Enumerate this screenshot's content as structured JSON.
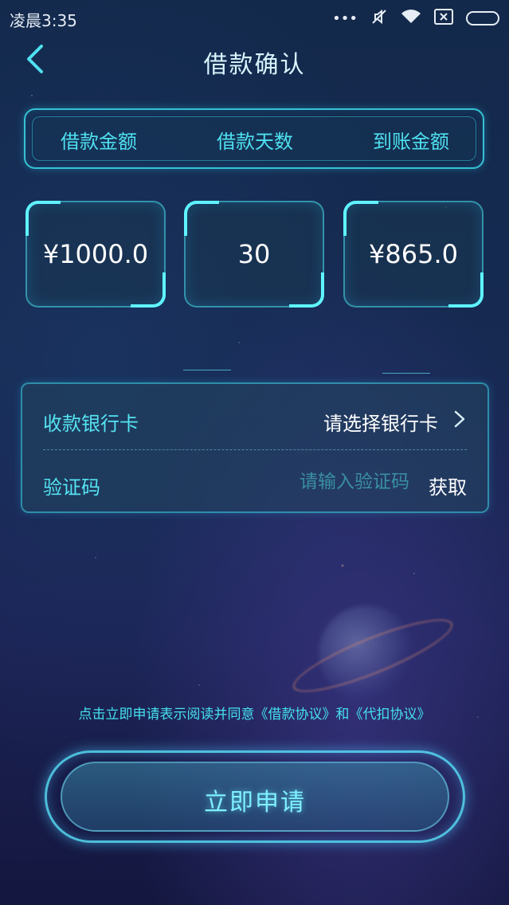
{
  "status_bar": {
    "time": "凌晨3:35"
  },
  "nav": {
    "title": "借款确认"
  },
  "summary": {
    "labels": [
      "借款金额",
      "借款天数",
      "到账金额"
    ],
    "values": [
      "¥1000.0",
      "30",
      "¥865.0"
    ]
  },
  "form": {
    "bank_card": {
      "label": "收款银行卡",
      "value": "请选择银行卡"
    },
    "verify_code": {
      "label": "验证码",
      "placeholder": "请输入验证码",
      "get_label": "获取"
    }
  },
  "agreement_text": "点击立即申请表示阅读并同意《借款协议》和《代扣协议》",
  "submit_label": "立即申请",
  "colors": {
    "accent": "#4fe0f0",
    "text": "#ffffff",
    "background": "#162a52"
  }
}
